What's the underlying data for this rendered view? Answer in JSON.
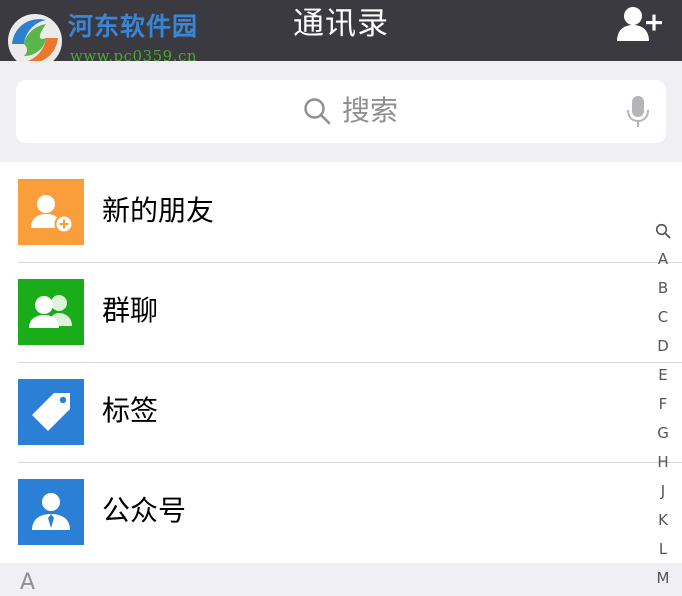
{
  "header": {
    "title": "通讯录",
    "add_icon": "add-contact-icon"
  },
  "watermark": {
    "site_name": "河东软件园",
    "url": "www.pc0359.cn"
  },
  "search": {
    "placeholder": "搜索",
    "icon": "search-icon",
    "mic_icon": "microphone-icon"
  },
  "list": {
    "items": [
      {
        "label": "新的朋友",
        "icon": "new-friend-icon",
        "color": "#fa9d3b"
      },
      {
        "label": "群聊",
        "icon": "group-chat-icon",
        "color": "#1aad19"
      },
      {
        "label": "标签",
        "icon": "tag-icon",
        "color": "#2b7fd4"
      },
      {
        "label": "公众号",
        "icon": "official-account-icon",
        "color": "#2b7fd4"
      }
    ]
  },
  "section": {
    "letter": "A"
  },
  "index_bar": {
    "entries": [
      "A",
      "B",
      "C",
      "D",
      "E",
      "F",
      "G",
      "H",
      "J",
      "K",
      "L",
      "M"
    ]
  },
  "colors": {
    "header_bg": "#3b3a40",
    "page_bg": "#efeff4",
    "watermark_blue": "#3a86d6",
    "watermark_green": "#4ea63b"
  }
}
